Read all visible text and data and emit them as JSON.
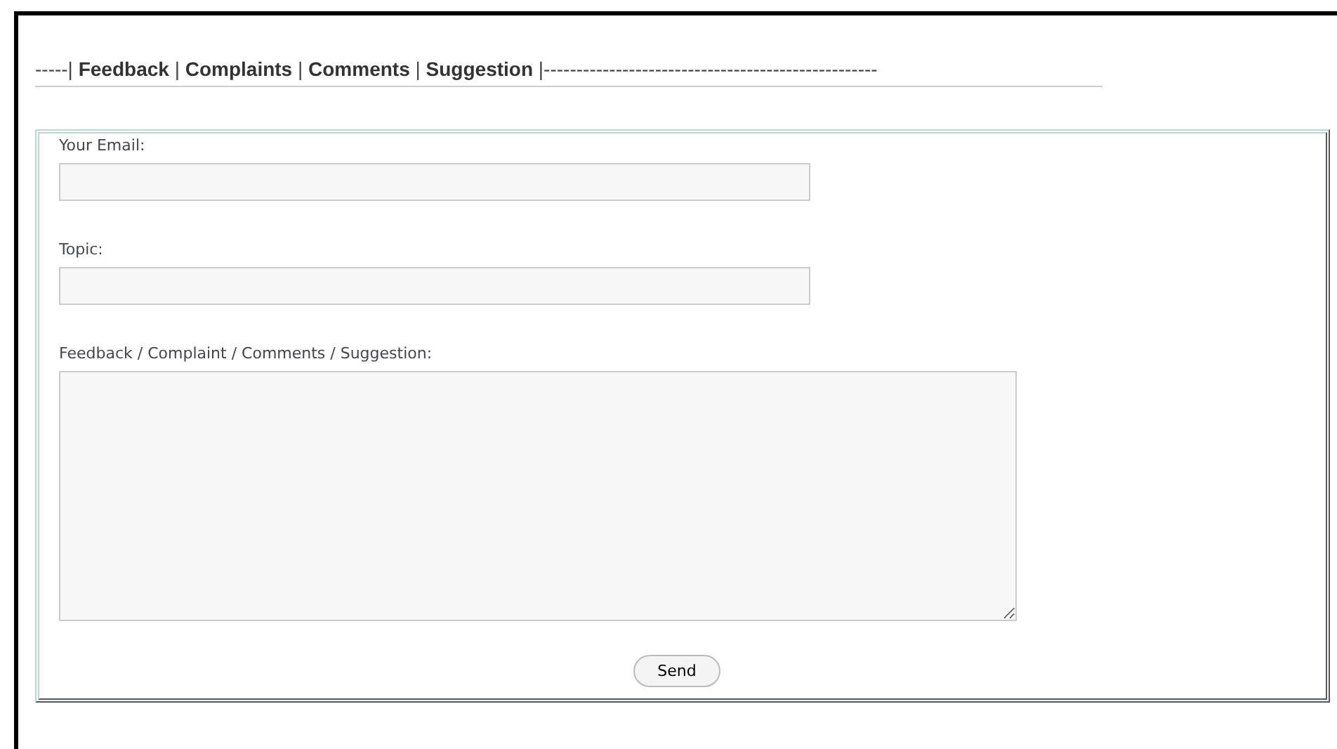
{
  "heading": "-----| **Feedback** | **Complaints** | **Comments** | **Suggestion** |---------------------------------------------------",
  "fields": [
    {
      "kind": "input",
      "label": "Your Email:"
    },
    {
      "kind": "input",
      "label": "Topic:"
    },
    {
      "kind": "textarea",
      "label": "Feedback / Complaint / Comments / Suggestion:"
    }
  ],
  "button": "Send"
}
